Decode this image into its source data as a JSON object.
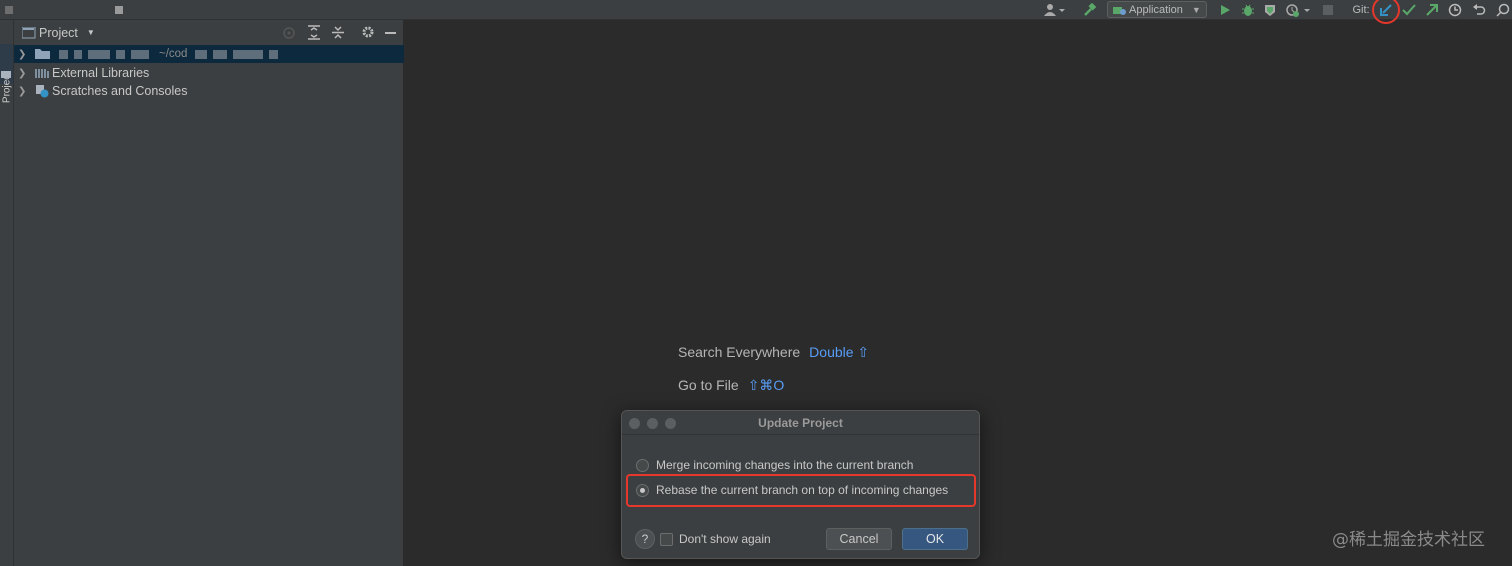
{
  "toolbar": {
    "run_config": "Application",
    "git_label": "Git:",
    "colors": {
      "run": "#59a869",
      "debug": "#59a869",
      "git_update": "#3592c4",
      "highlight": "#e5372b"
    },
    "icons": [
      "hammer-icon",
      "run-icon",
      "debug-icon",
      "coverage-icon",
      "profile-icon",
      "stop-icon",
      "git-update-icon",
      "git-commit-icon",
      "git-push-icon",
      "history-icon",
      "rollback-icon",
      "search-icon"
    ]
  },
  "left_stripe": {
    "project_tab": "Project"
  },
  "project_panel": {
    "title": "Project",
    "tree": [
      {
        "label": "~/cod",
        "selected": true
      },
      {
        "label": "External Libraries",
        "selected": false
      },
      {
        "label": "Scratches and Consoles",
        "selected": false
      }
    ]
  },
  "editor": {
    "hints": [
      {
        "label": "Search Everywhere",
        "shortcut": "Double ⇧"
      },
      {
        "label": "Go to File",
        "shortcut": "⇧⌘O"
      }
    ]
  },
  "dialog": {
    "title": "Update Project",
    "options": [
      {
        "label": "Merge incoming changes into the current branch",
        "selected": false
      },
      {
        "label": "Rebase the current branch on top of incoming changes",
        "selected": true
      }
    ],
    "help": "?",
    "dont_show_again": "Don't show again",
    "cancel": "Cancel",
    "ok": "OK"
  },
  "watermark": "@稀土掘金技术社区"
}
